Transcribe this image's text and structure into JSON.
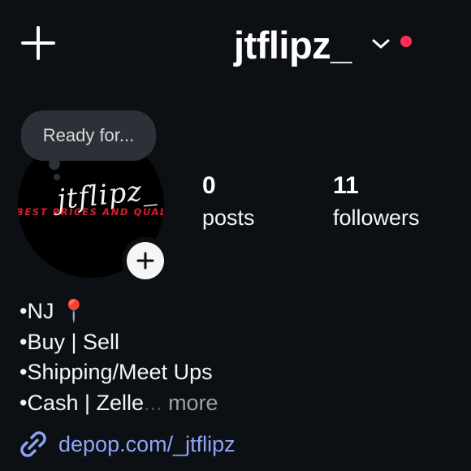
{
  "header": {
    "username": "jtflipz_",
    "new_post_icon": "plus-icon",
    "switch_account_icon": "chevron-down-icon",
    "notification_color": "#ff2d55"
  },
  "profile": {
    "note": "Ready for...",
    "avatar_logo_text": "jtflipz_",
    "avatar_tagline": "BEST PRICES AND QUALI",
    "add_story_icon": "plus-icon"
  },
  "stats": [
    {
      "value": "0",
      "label": "posts"
    },
    {
      "value": "11",
      "label": "followers"
    }
  ],
  "bio": {
    "lines": [
      "•NJ 📍",
      "•Buy | Sell",
      "•Shipping/Meet Ups",
      "•Cash | Zelle"
    ],
    "ellipsis": "...",
    "more_label": "more"
  },
  "link": {
    "icon": "link-icon",
    "text": "depop.com/_jtflipz",
    "color": "#8fa5f5"
  }
}
